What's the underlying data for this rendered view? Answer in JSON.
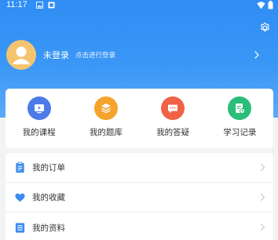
{
  "status_bar": {
    "time": "11:17",
    "icons": [
      "gallery-icon",
      "notification-icon",
      "wifi-icon",
      "battery-icon"
    ]
  },
  "header": {
    "settings_icon": "gear-icon"
  },
  "profile": {
    "name": "未登录",
    "hint": "点击进行登录"
  },
  "quick_actions": [
    {
      "label": "我的课程",
      "icon": "video-icon",
      "color": "#4c7be8"
    },
    {
      "label": "我的题库",
      "icon": "layers-icon",
      "color": "#f4a32c"
    },
    {
      "label": "我的答疑",
      "icon": "message-icon",
      "color": "#ef6247"
    },
    {
      "label": "学习记录",
      "icon": "record-icon",
      "color": "#2bbd7a"
    }
  ],
  "menu": [
    {
      "label": "我的订单",
      "icon": "clipboard-icon"
    },
    {
      "label": "我的收藏",
      "icon": "heart-icon"
    },
    {
      "label": "我的资料",
      "icon": "document-icon"
    }
  ],
  "colors": {
    "primary": "#2f8df4",
    "icon_blue": "#3b8cf2"
  }
}
